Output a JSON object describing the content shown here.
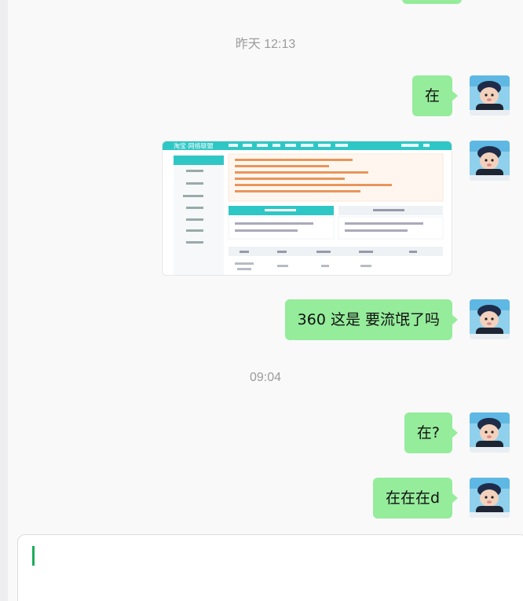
{
  "timestamps": [
    "昨天 12:13",
    "09:04"
  ],
  "messages": [
    {
      "type": "text",
      "text": "在"
    },
    {
      "type": "image",
      "description_label": "screenshot"
    },
    {
      "type": "text",
      "text": "360  这是 要流氓了吗"
    },
    {
      "type": "text",
      "text": "在?"
    },
    {
      "type": "text",
      "text": "在在在d"
    }
  ],
  "colors": {
    "bubble": "#95ec9b",
    "background": "#f9f9f9",
    "caret": "#1aad5a",
    "screenshot_accent": "#2fc7c5"
  },
  "icons": {
    "avatar": "baby-photo-avatar"
  }
}
